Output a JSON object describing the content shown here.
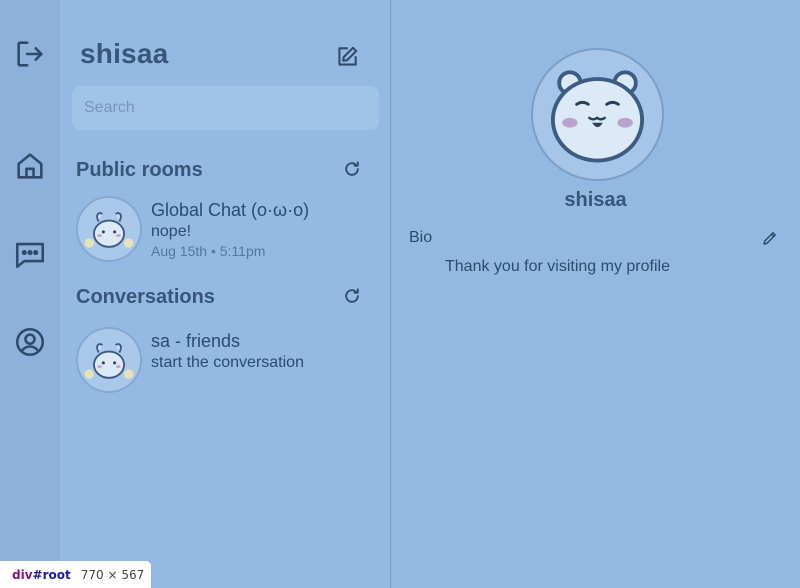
{
  "rail": {
    "icons": [
      "logout-icon",
      "home-icon",
      "chat-icon",
      "profile-icon"
    ]
  },
  "sidebar": {
    "username": "shisaa",
    "search_placeholder": "Search",
    "public_rooms_title": "Public rooms",
    "conversations_title": "Conversations",
    "public_rooms": [
      {
        "name": "Global Chat (o·ω·o)",
        "last_message": "nope!",
        "time": "Aug 15th • 5:11pm"
      }
    ],
    "conversations": [
      {
        "name": "sa - friends",
        "last_message": "start the conversation"
      }
    ]
  },
  "profile": {
    "name": "shisaa",
    "bio_label": "Bio",
    "bio_text": "Thank you for visiting my profile"
  },
  "devtools_tag": {
    "element": "div",
    "id": "#root",
    "size": "770 × 567"
  },
  "colors": {
    "background": "#93b9e3",
    "rail": "#8db1da",
    "text": "#2f4a6b",
    "icon": "#2f4a6b"
  }
}
